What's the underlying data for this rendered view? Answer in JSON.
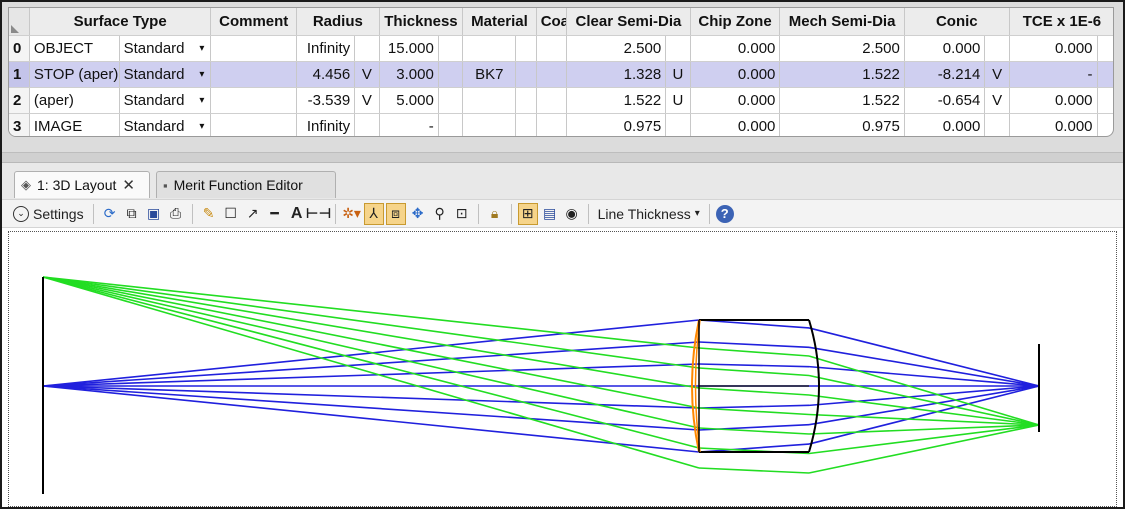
{
  "lens_editor": {
    "columns": [
      "Surface Type",
      "Comment",
      "Radius",
      "Thickness",
      "Material",
      "Coating",
      "Clear Semi-Dia",
      "Chip Zone",
      "Mech Semi-Dia",
      "Conic",
      "TCE x 1E-6"
    ],
    "rows": [
      {
        "index": "0",
        "name": "OBJECT",
        "type": "Standard",
        "comment": "",
        "radius": "Infinity",
        "radius_solve": "",
        "thickness": "15.000",
        "thickness_solve": "",
        "material": "",
        "coating": "",
        "clear_semi_dia": "2.500",
        "clear_solve": "",
        "chip_zone": "0.000",
        "mech_semi_dia": "2.500",
        "conic": "0.000",
        "conic_solve": "",
        "tce": "0.000"
      },
      {
        "index": "1",
        "name": "STOP (aper)",
        "type": "Standard",
        "comment": "",
        "radius": "4.456",
        "radius_solve": "V",
        "thickness": "3.000",
        "thickness_solve": "",
        "material": "BK7",
        "coating": "",
        "clear_semi_dia": "1.328",
        "clear_solve": "U",
        "chip_zone": "0.000",
        "mech_semi_dia": "1.522",
        "conic": "-8.214",
        "conic_solve": "V",
        "tce": "-"
      },
      {
        "index": "2",
        "name": "(aper)",
        "type": "Standard",
        "comment": "",
        "radius": "-3.539",
        "radius_solve": "V",
        "thickness": "5.000",
        "thickness_solve": "",
        "material": "",
        "coating": "",
        "clear_semi_dia": "1.522",
        "clear_solve": "U",
        "chip_zone": "0.000",
        "mech_semi_dia": "1.522",
        "conic": "-0.654",
        "conic_solve": "V",
        "tce": "0.000"
      },
      {
        "index": "3",
        "name": "IMAGE",
        "type": "Standard",
        "comment": "",
        "radius": "Infinity",
        "radius_solve": "",
        "thickness": "-",
        "thickness_solve": "",
        "material": "",
        "coating": "",
        "clear_semi_dia": "0.975",
        "clear_solve": "",
        "chip_zone": "0.000",
        "mech_semi_dia": "0.975",
        "conic": "0.000",
        "conic_solve": "",
        "tce": "0.000"
      }
    ],
    "selected_row": 1,
    "dropdown_arrow": "▾"
  },
  "tabs": [
    {
      "label": "1: 3D Layout",
      "icon": "3d-layout-icon",
      "active": true,
      "close": "✕"
    },
    {
      "label": "Merit Function Editor",
      "icon": "merit-function-icon",
      "active": false
    }
  ],
  "toolbar": {
    "settings_label": "Settings",
    "line_thickness_label": "Line Thickness",
    "icons": [
      "refresh-icon",
      "copy-icon",
      "save-icon",
      "print-icon",
      "pencil-icon",
      "rectangle-icon",
      "arrow-icon",
      "line-icon",
      "text-icon",
      "dimension-icon",
      "rotate-view-icon",
      "axes-icon",
      "fit-view-icon",
      "pan-icon",
      "zoom-icon",
      "zoom-box-icon",
      "lock-icon",
      "crosshair-icon",
      "window-icon",
      "record-icon",
      "help-icon"
    ]
  },
  "layout_plot": {
    "colors": {
      "field1": "#2020dd",
      "field2": "#22dd22",
      "lens_edge": "#ff8800",
      "surface": "#000000"
    }
  }
}
